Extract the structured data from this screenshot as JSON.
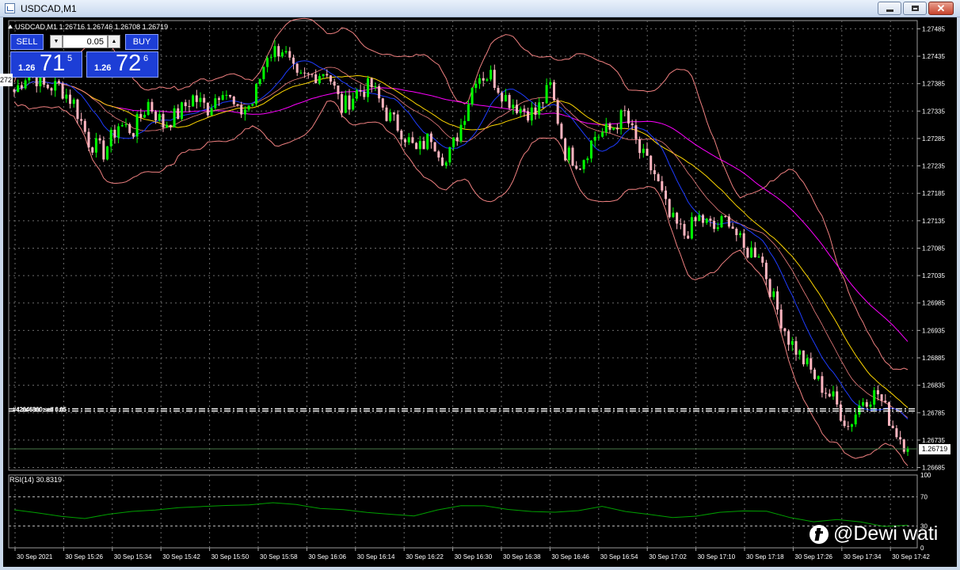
{
  "window": {
    "title": "USDCAD,M1"
  },
  "chart_header": {
    "text": "USDCAD,M1  1.26716 1.26746 1.26708 1.26719"
  },
  "trade_panel": {
    "sell_label": "SELL",
    "buy_label": "BUY",
    "lot": "0.05",
    "sell_quote": {
      "big": "1.26",
      "main": "71",
      "sup": "5"
    },
    "buy_quote": {
      "big": "1.26",
      "main": "72",
      "sup": "6"
    }
  },
  "left_tag": "272",
  "order_lines_label": "#42646860 sell 0.05",
  "current_price_label": "1.26719",
  "rsi": {
    "label": "RSI(14) 30.8319",
    "levels": [
      "100",
      "70",
      "30",
      "0"
    ]
  },
  "watermark": "@Dewi wati",
  "colors": {
    "bull": "#00ff00",
    "bear": "#ffb6c1",
    "bands": "#f08080",
    "ma_fast": "#1e3cff",
    "ma_mid": "#ffd700",
    "ma_slow": "#ff00ff",
    "rsi_line": "#00a000",
    "grid": "#6b6b6b"
  },
  "chart_data": {
    "type": "candlestick",
    "symbol": "USDCAD",
    "timeframe": "M1",
    "y_ticks": [
      "1.27485",
      "1.27435",
      "1.27385",
      "1.27335",
      "1.27285",
      "1.27235",
      "1.27185",
      "1.27135",
      "1.27085",
      "1.27035",
      "1.26985",
      "1.26935",
      "1.26885",
      "1.26835",
      "1.26785",
      "1.26735",
      "1.26685"
    ],
    "ylim": [
      1.2668,
      1.275
    ],
    "x_ticks": [
      "30 Sep 2021",
      "30 Sep 15:26",
      "30 Sep 15:34",
      "30 Sep 15:42",
      "30 Sep 15:50",
      "30 Sep 15:58",
      "30 Sep 16:06",
      "30 Sep 16:14",
      "30 Sep 16:22",
      "30 Sep 16:30",
      "30 Sep 16:38",
      "30 Sep 16:46",
      "30 Sep 16:54",
      "30 Sep 17:02",
      "30 Sep 17:10",
      "30 Sep 17:18",
      "30 Sep 17:26",
      "30 Sep 17:34",
      "30 Sep 17:42"
    ],
    "order_levels": [
      1.26792,
      1.26788
    ],
    "current_price": 1.26719,
    "close_anchors": [
      1.2737,
      1.2741,
      1.2738,
      1.2738,
      1.2735,
      1.2728,
      1.2726,
      1.2731,
      1.273,
      1.2735,
      1.2731,
      1.2733,
      1.2736,
      1.2734,
      1.2738,
      1.2733,
      1.2735,
      1.2744,
      1.2745,
      1.2739,
      1.274,
      1.2741,
      1.2734,
      1.2737,
      1.2738,
      1.2733,
      1.273,
      1.2726,
      1.2729,
      1.2724,
      1.2731,
      1.274,
      1.274,
      1.2736,
      1.2734,
      1.2733,
      1.2738,
      1.2726,
      1.2724,
      1.2729,
      1.273,
      1.2733,
      1.2726,
      1.2722,
      1.2714,
      1.2711,
      1.2714,
      1.2712,
      1.2714,
      1.2708,
      1.2708,
      1.2699,
      1.2692,
      1.2688,
      1.2684,
      1.2681,
      1.2676,
      1.2681,
      1.2682,
      1.2676,
      1.2672
    ],
    "rsi_ylim": [
      0,
      100
    ],
    "rsi_levels": [
      70,
      30
    ],
    "rsi_anchors": [
      52,
      48,
      44,
      42,
      45,
      50,
      53,
      55,
      56,
      58,
      60,
      63,
      60,
      55,
      52,
      50,
      48,
      45,
      53,
      56,
      58,
      54,
      50,
      48,
      52,
      55,
      50,
      44,
      40,
      45,
      48,
      50,
      52,
      40,
      35,
      38,
      34,
      30,
      31
    ]
  }
}
